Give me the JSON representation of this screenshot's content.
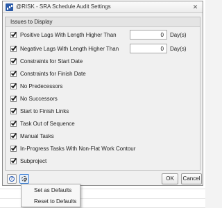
{
  "window": {
    "title": "@RISK - SRA Schedule Audit Settings",
    "app_icon": "risk-chart-icon",
    "close_glyph": "✕"
  },
  "section": {
    "title": "Issues to Display"
  },
  "options": [
    {
      "label": "Positive Lags With Length Higher Than",
      "checked": true,
      "value": "0",
      "unit": "Day(s)"
    },
    {
      "label": "Negative Lags With Length Higher Than",
      "checked": true,
      "value": "0",
      "unit": "Day(s)"
    },
    {
      "label": "Constraints for Start Date",
      "checked": true
    },
    {
      "label": "Constraints for Finish Date",
      "checked": true
    },
    {
      "label": "No Predecessors",
      "checked": true
    },
    {
      "label": "No Successors",
      "checked": true
    },
    {
      "label": "Start to Finish Links",
      "checked": true
    },
    {
      "label": "Task Out of Sequence",
      "checked": true
    },
    {
      "label": "Manual Tasks",
      "checked": true
    },
    {
      "label": "In-Progress Tasks With Non-Flat Work Contour",
      "checked": true
    },
    {
      "label": "Subproject",
      "checked": true
    }
  ],
  "footer": {
    "help_icon": "help-icon",
    "help_glyph": "?",
    "settings_icon": "gear-icon",
    "ok_label": "OK",
    "cancel_label": "Cancel"
  },
  "menu": {
    "items": [
      {
        "label": "Set as Defaults"
      },
      {
        "label": "Reset to Defaults"
      }
    ]
  }
}
